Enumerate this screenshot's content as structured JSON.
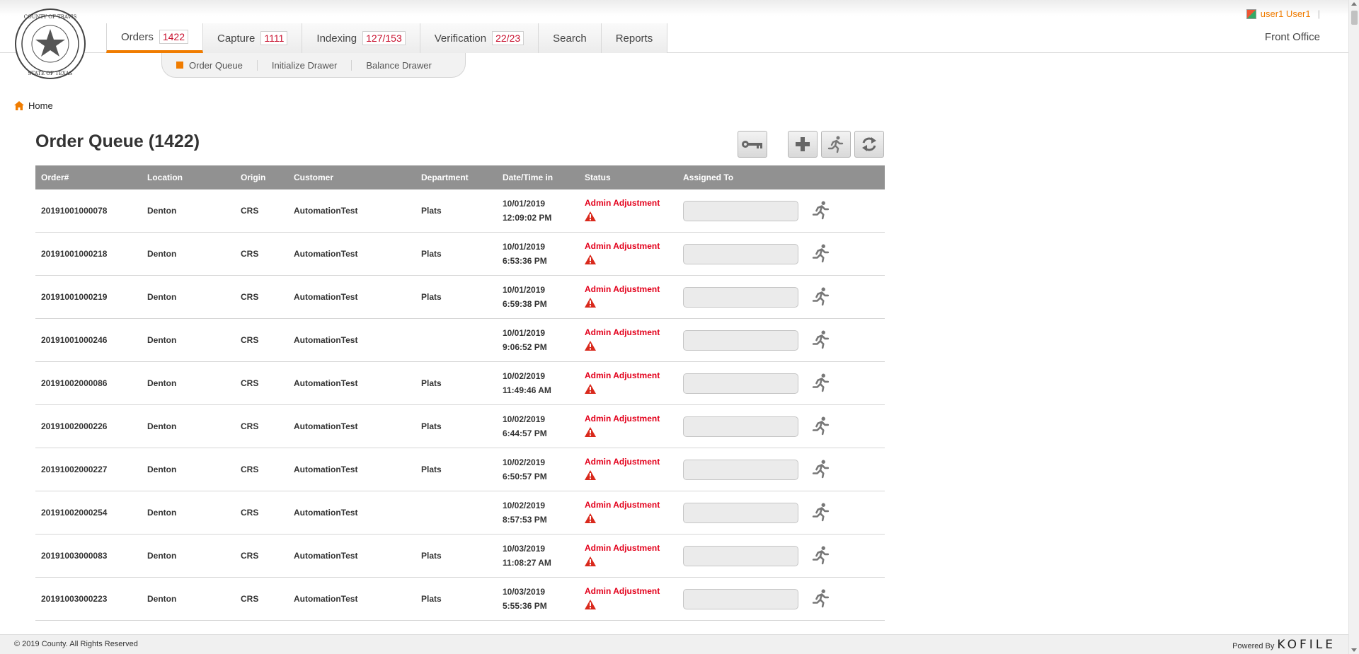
{
  "user": {
    "name": "user1 User1",
    "separator": "|"
  },
  "nav": {
    "tabs": [
      {
        "label": "Orders",
        "count": "1422"
      },
      {
        "label": "Capture",
        "count": "1111"
      },
      {
        "label": "Indexing",
        "count": "127/153"
      },
      {
        "label": "Verification",
        "count": "22/23"
      },
      {
        "label": "Search",
        "count": null
      },
      {
        "label": "Reports",
        "count": null
      }
    ],
    "front_office": "Front Office"
  },
  "subnav": {
    "items": [
      "Order Queue",
      "Initialize Drawer",
      "Balance Drawer"
    ]
  },
  "breadcrumb": {
    "home": "Home"
  },
  "page": {
    "title": "Order Queue (1422)"
  },
  "table": {
    "headers": [
      "Order#",
      "Location",
      "Origin",
      "Customer",
      "Department",
      "Date/Time in",
      "Status",
      "Assigned To"
    ],
    "rows": [
      {
        "order": "20191001000078",
        "location": "Denton",
        "origin": "CRS",
        "customer": "AutomationTest",
        "department": "Plats",
        "date": "10/01/2019",
        "time": "12:09:02 PM",
        "status": "Admin Adjustment"
      },
      {
        "order": "20191001000218",
        "location": "Denton",
        "origin": "CRS",
        "customer": "AutomationTest",
        "department": "Plats",
        "date": "10/01/2019",
        "time": "6:53:36 PM",
        "status": "Admin Adjustment"
      },
      {
        "order": "20191001000219",
        "location": "Denton",
        "origin": "CRS",
        "customer": "AutomationTest",
        "department": "Plats",
        "date": "10/01/2019",
        "time": "6:59:38 PM",
        "status": "Admin Adjustment"
      },
      {
        "order": "20191001000246",
        "location": "Denton",
        "origin": "CRS",
        "customer": "AutomationTest",
        "department": "",
        "date": "10/01/2019",
        "time": "9:06:52 PM",
        "status": "Admin Adjustment"
      },
      {
        "order": "20191002000086",
        "location": "Denton",
        "origin": "CRS",
        "customer": "AutomationTest",
        "department": "Plats",
        "date": "10/02/2019",
        "time": "11:49:46 AM",
        "status": "Admin Adjustment"
      },
      {
        "order": "20191002000226",
        "location": "Denton",
        "origin": "CRS",
        "customer": "AutomationTest",
        "department": "Plats",
        "date": "10/02/2019",
        "time": "6:44:57 PM",
        "status": "Admin Adjustment"
      },
      {
        "order": "20191002000227",
        "location": "Denton",
        "origin": "CRS",
        "customer": "AutomationTest",
        "department": "Plats",
        "date": "10/02/2019",
        "time": "6:50:57 PM",
        "status": "Admin Adjustment"
      },
      {
        "order": "20191002000254",
        "location": "Denton",
        "origin": "CRS",
        "customer": "AutomationTest",
        "department": "",
        "date": "10/02/2019",
        "time": "8:57:53 PM",
        "status": "Admin Adjustment"
      },
      {
        "order": "20191003000083",
        "location": "Denton",
        "origin": "CRS",
        "customer": "AutomationTest",
        "department": "Plats",
        "date": "10/03/2019",
        "time": "11:08:27 AM",
        "status": "Admin Adjustment"
      },
      {
        "order": "20191003000223",
        "location": "Denton",
        "origin": "CRS",
        "customer": "AutomationTest",
        "department": "Plats",
        "date": "10/03/2019",
        "time": "5:55:36 PM",
        "status": "Admin Adjustment"
      }
    ]
  },
  "footer": {
    "copyright": "© 2019 County. All Rights Reserved",
    "powered_by": "Powered By",
    "brand": "KOFILE"
  },
  "colors": {
    "accent": "#f07c00",
    "status_red": "#e3001b",
    "header_gray": "#919191"
  },
  "icons": {
    "seal": "county-seal-icon",
    "home": "home-icon",
    "key": "key-icon",
    "add": "plus-icon",
    "assign": "running-man-icon",
    "refresh": "refresh-icon",
    "warning": "warning-icon"
  }
}
